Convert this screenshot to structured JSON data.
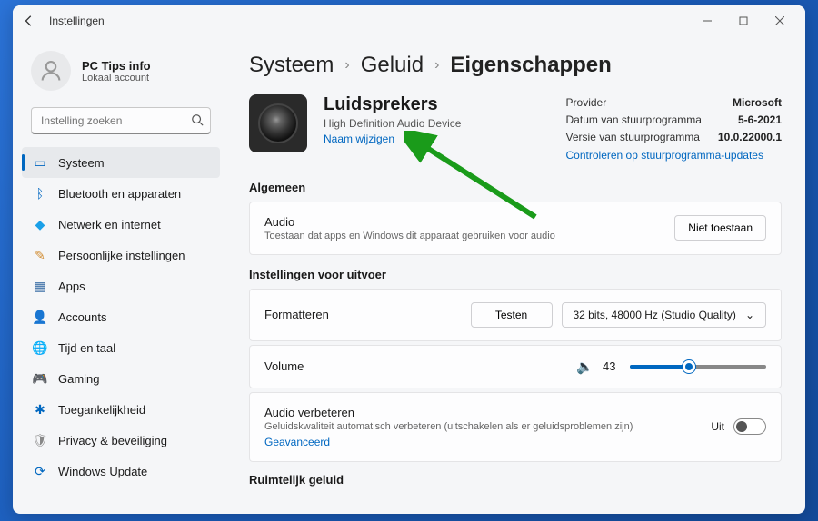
{
  "window": {
    "title": "Instellingen"
  },
  "user": {
    "name": "PC Tips info",
    "sub": "Lokaal account"
  },
  "search": {
    "placeholder": "Instelling zoeken"
  },
  "sidebar": {
    "items": [
      {
        "label": "Systeem",
        "icon": "🖥️",
        "color": "#0067c0"
      },
      {
        "label": "Bluetooth en apparaten",
        "icon": "ᛒ",
        "color": "#0067c0"
      },
      {
        "label": "Netwerk en internet",
        "icon": "◆",
        "color": "#1aa0e8"
      },
      {
        "label": "Persoonlijke instellingen",
        "icon": "✎",
        "color": "#d08a2e"
      },
      {
        "label": "Apps",
        "icon": "▦",
        "color": "#3a6ea5"
      },
      {
        "label": "Accounts",
        "icon": "👤",
        "color": "#2e8b57"
      },
      {
        "label": "Tijd en taal",
        "icon": "🌐",
        "color": "#3a6ea5"
      },
      {
        "label": "Gaming",
        "icon": "🎮",
        "color": "#777"
      },
      {
        "label": "Toegankelijkheid",
        "icon": "✱",
        "color": "#0067c0"
      },
      {
        "label": "Privacy & beveiliging",
        "icon": "🛡",
        "color": "#888"
      },
      {
        "label": "Windows Update",
        "icon": "⟳",
        "color": "#0067c0"
      }
    ]
  },
  "breadcrumb": {
    "a": "Systeem",
    "b": "Geluid",
    "c": "Eigenschappen"
  },
  "device": {
    "title": "Luidsprekers",
    "sub": "High Definition Audio Device",
    "rename": "Naam wijzigen"
  },
  "driver": {
    "provider_label": "Provider",
    "provider_value": "Microsoft",
    "date_label": "Datum van stuurprogramma",
    "date_value": "5-6-2021",
    "version_label": "Versie van stuurprogramma",
    "version_value": "10.0.22000.1",
    "check_link": "Controleren op stuurprogramma-updates"
  },
  "sections": {
    "general": "Algemeen",
    "output": "Instellingen voor uitvoer",
    "spatial": "Ruimtelijk geluid"
  },
  "audio_card": {
    "title": "Audio",
    "sub": "Toestaan dat apps en Windows dit apparaat gebruiken voor audio",
    "button": "Niet toestaan"
  },
  "format_card": {
    "label": "Formatteren",
    "test": "Testen",
    "value": "32 bits, 48000 Hz (Studio Quality)"
  },
  "volume_card": {
    "label": "Volume",
    "value": "43",
    "percent": 43
  },
  "enhance_card": {
    "title": "Audio verbeteren",
    "sub": "Geluidskwaliteit automatisch verbeteren (uitschakelen als er geluidsproblemen zijn)",
    "adv": "Geavanceerd",
    "state": "Uit"
  }
}
